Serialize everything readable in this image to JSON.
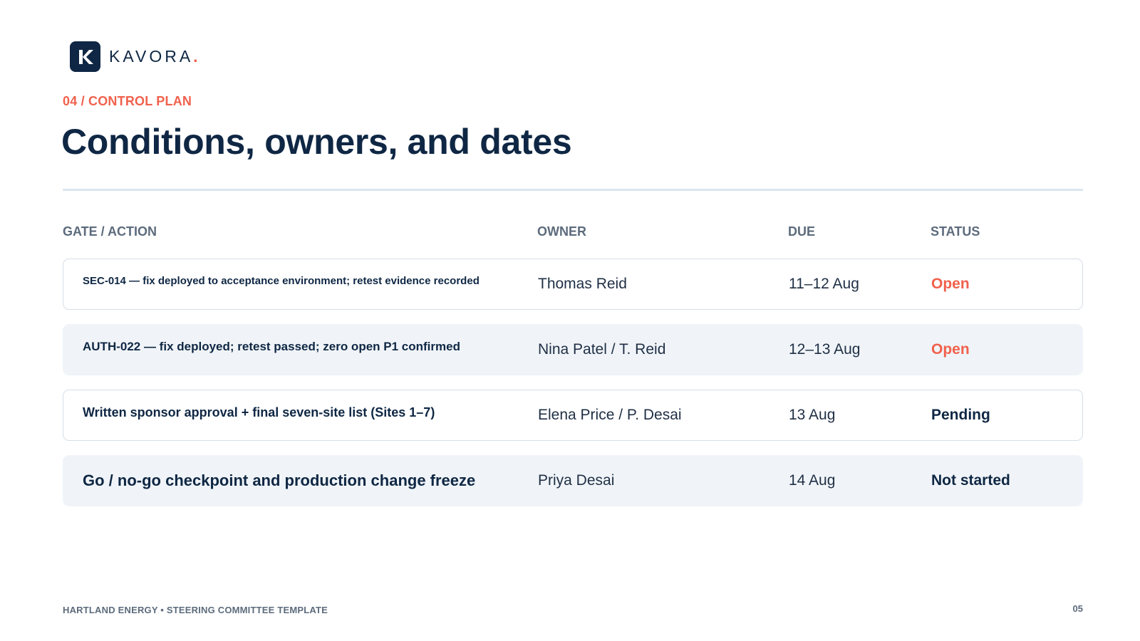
{
  "brand": {
    "name": "KAVORA",
    "dot": ".",
    "accent_color": "#f0614c",
    "primary_color": "#0f2744",
    "logo_icon": "k-logo-icon"
  },
  "section_label": "04 / CONTROL PLAN",
  "title": "Conditions, owners, and dates",
  "table": {
    "headers": {
      "gate": "GATE / ACTION",
      "owner": "OWNER",
      "due": "DUE",
      "status": "STATUS"
    },
    "rows": [
      {
        "gate": "SEC-014 — fix deployed to acceptance environment; retest evidence recorded",
        "owner": "Thomas Reid",
        "due": "11–12 Aug",
        "status": "Open"
      },
      {
        "gate": "AUTH-022 — fix deployed; retest passed; zero open P1 confirmed",
        "owner": "Nina Patel / T. Reid",
        "due": "12–13 Aug",
        "status": "Open"
      },
      {
        "gate": "Written sponsor approval + final seven-site list (Sites 1–7)",
        "owner": "Elena Price / P. Desai",
        "due": "13 Aug",
        "status": "Pending"
      },
      {
        "gate": "Go / no-go checkpoint and production change freeze",
        "owner": "Priya Desai",
        "due": "14 Aug",
        "status": "Not started"
      }
    ]
  },
  "footer": {
    "left": "HARTLAND ENERGY • STEERING COMMITTEE TEMPLATE",
    "page_number": "05"
  }
}
